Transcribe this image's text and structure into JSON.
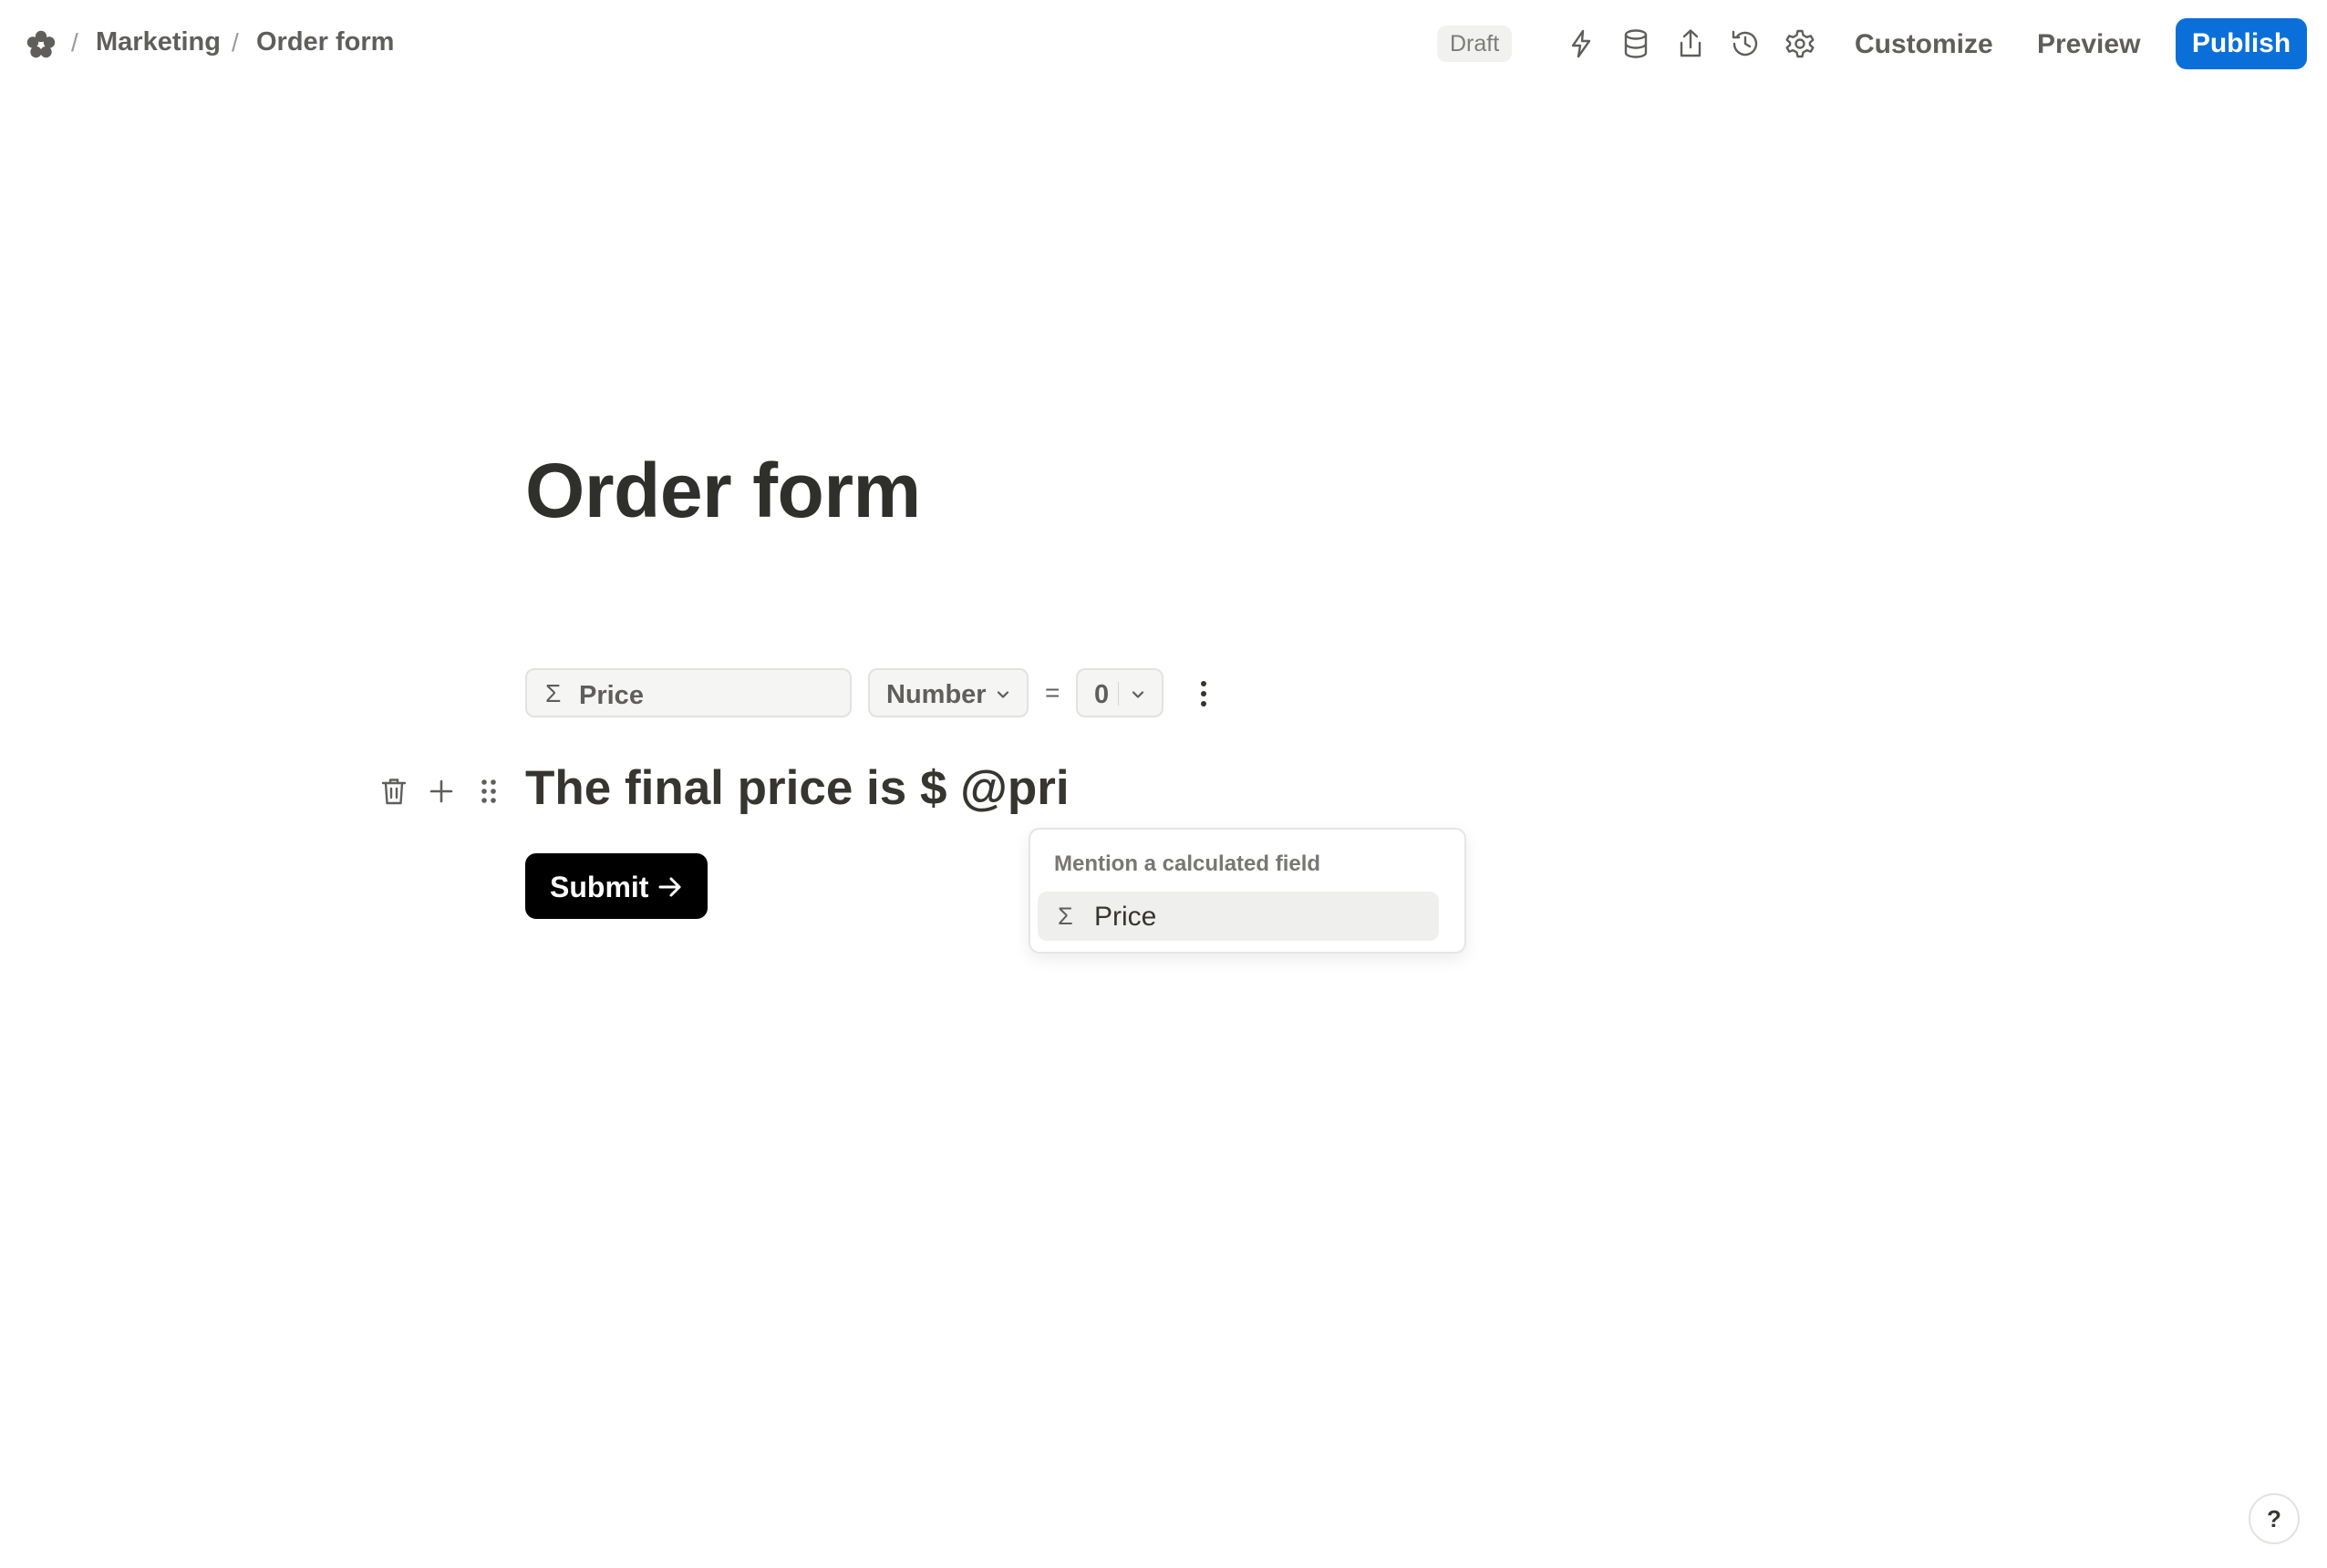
{
  "header": {
    "logo_icon": "flower-logo-icon",
    "breadcrumb": [
      {
        "label": "Marketing"
      },
      {
        "label": "Order form"
      }
    ],
    "separator": "/",
    "status_badge": "Draft",
    "toolbar_icons": [
      "lightning-icon",
      "database-icon",
      "share-icon",
      "history-icon",
      "gear-icon"
    ],
    "customize_label": "Customize",
    "preview_label": "Preview",
    "publish_label": "Publish",
    "accent_color": "#0b6fd9"
  },
  "form": {
    "title": "Order form",
    "calculated_field": {
      "icon": "sigma-icon",
      "name": "Price",
      "type": "Number",
      "operator": "=",
      "value": "0"
    },
    "text_block": {
      "content": "The final price is $ @pri"
    },
    "submit_label": "Submit"
  },
  "mention_popup": {
    "heading": "Mention a calculated field",
    "items": [
      {
        "icon": "sigma-icon",
        "label": "Price"
      }
    ]
  },
  "help_label": "?"
}
